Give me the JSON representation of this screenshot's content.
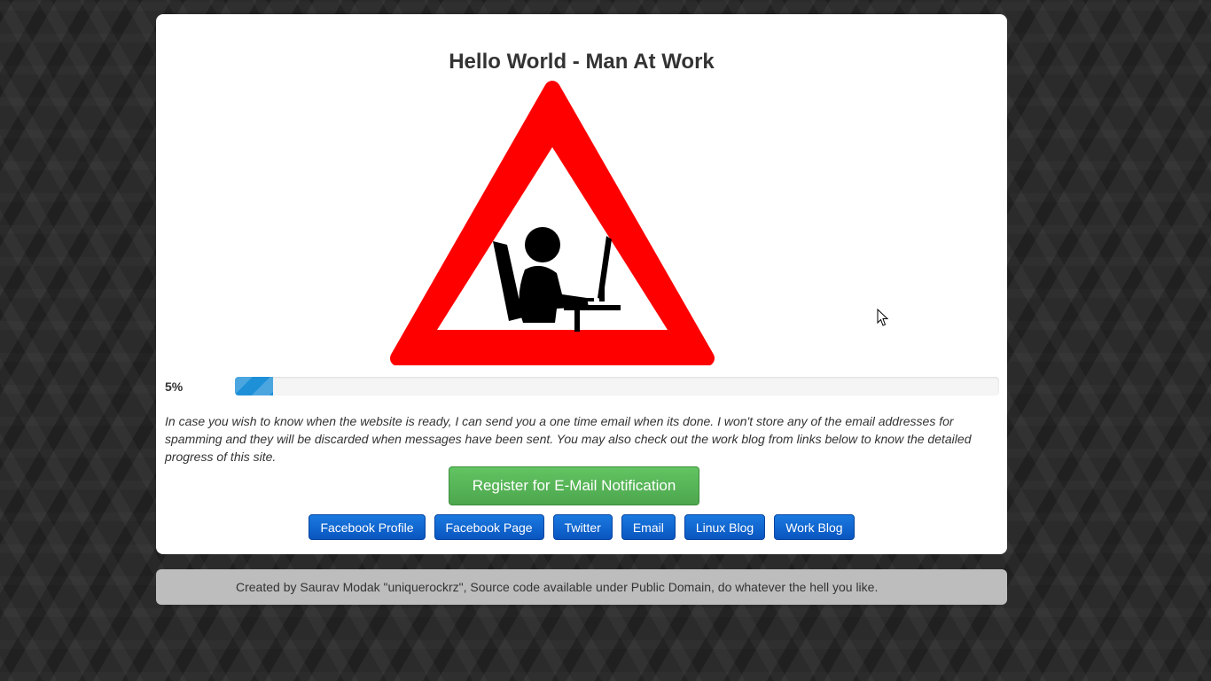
{
  "page": {
    "title": "Hello World - Man At Work",
    "sign_icon": "man-at-work-warning-sign",
    "progress": {
      "label": "5%",
      "value": 0.05,
      "color": "#1e90d8"
    },
    "note": "In case you wish to know when the website is ready, I can send you a one time email when its done. I won't store any of the email addresses for spamming and they will be discarded when messages have been sent. You may also check out the work blog from links below to know the detailed progress of this site.",
    "register_label": "Register for E-Mail Notification",
    "links": [
      {
        "name": "facebook-profile-button",
        "label": "Facebook Profile"
      },
      {
        "name": "facebook-page-button",
        "label": "Facebook Page"
      },
      {
        "name": "twitter-button",
        "label": "Twitter"
      },
      {
        "name": "email-button",
        "label": "Email"
      },
      {
        "name": "linux-blog-button",
        "label": "Linux Blog"
      },
      {
        "name": "work-blog-button",
        "label": "Work Blog"
      }
    ]
  },
  "footer": {
    "text": "Created by Saurav Modak \"uniquerockrz\", Source code available under Public Domain, do whatever the hell you like."
  },
  "colors": {
    "sign_red": "#ff0000",
    "register_green": "#5cb85c",
    "link_blue": "#0d63d0"
  }
}
